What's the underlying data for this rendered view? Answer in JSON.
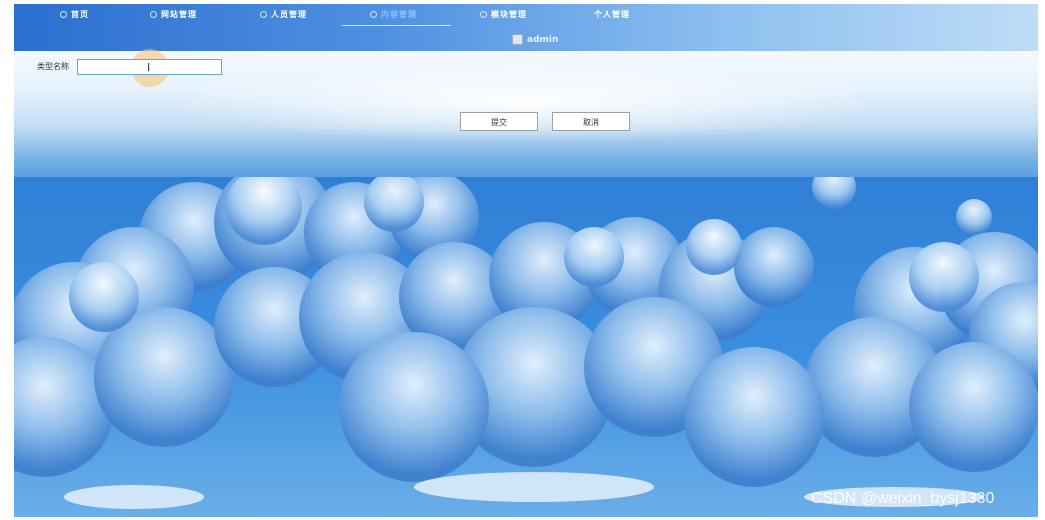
{
  "nav": {
    "items": [
      {
        "label": "首页",
        "active": false
      },
      {
        "label": "网站管理",
        "active": false
      },
      {
        "label": "人员管理",
        "active": false
      },
      {
        "label": "内容管理",
        "active": true
      },
      {
        "label": "模块管理",
        "active": false
      },
      {
        "label": "个人管理",
        "active": false
      }
    ]
  },
  "user": {
    "name": "admin"
  },
  "form": {
    "type_name_label": "类型名称",
    "type_name_value": "",
    "submit_label": "提交",
    "cancel_label": "取消"
  },
  "watermark": "CSDN @weixin_bysj1330",
  "colors": {
    "header_start": "#2b6fd0",
    "header_end": "#bfdcf6",
    "active_nav": "#8ec0ff"
  }
}
